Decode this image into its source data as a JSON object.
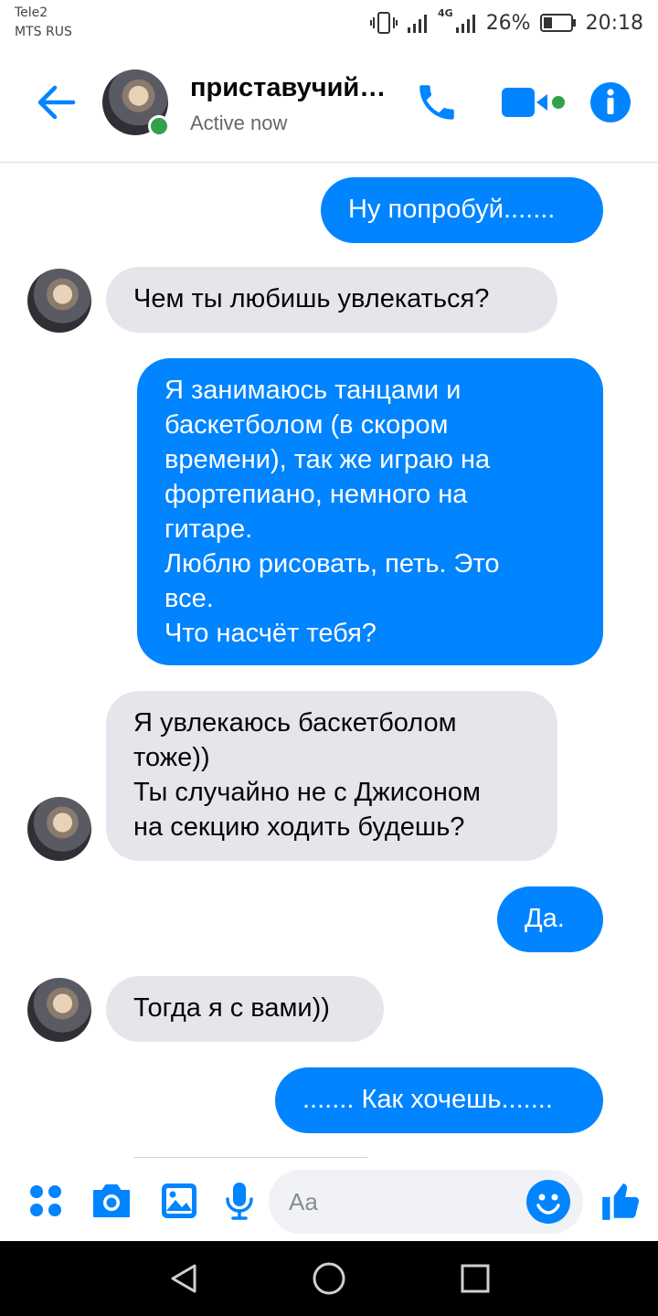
{
  "status_bar": {
    "carrier_line1": "Tele2",
    "carrier_line2": "MTS RUS",
    "network": "4G",
    "battery": "26%",
    "time": "20:18"
  },
  "header": {
    "contact_name": "приставучий…",
    "contact_status": "Active now",
    "icons": [
      "back-arrow-icon",
      "phone-icon",
      "video-camera-icon",
      "info-icon"
    ]
  },
  "messages": [
    {
      "direction": "outgoing",
      "text": "Ну попробуй......."
    },
    {
      "direction": "incoming",
      "text": "Чем ты любишь увлекаться?"
    },
    {
      "direction": "outgoing",
      "text": "Я занимаюсь танцами и\nбаскетболом (в скором\nвремени), так же играю на\nфортепиано, немного на\nгитаре.\nЛюблю рисовать, петь. Это\nвсе.\nЧто насчёт тебя?"
    },
    {
      "direction": "incoming",
      "text": "Я увлекаюсь баскетболом\nтоже))\nТы случайно не с Джисоном\nна секцию ходить будешь?"
    },
    {
      "direction": "outgoing",
      "text": "Да."
    },
    {
      "direction": "incoming",
      "text": "Тогда я с вами))"
    },
    {
      "direction": "outgoing",
      "text": "....... Как хочешь......."
    }
  ],
  "composer": {
    "placeholder": "Aa",
    "icons": [
      "apps-icon",
      "camera-icon",
      "gallery-icon",
      "microphone-icon",
      "emoji-icon",
      "like-icon"
    ]
  },
  "colors": {
    "accent": "#0084ff",
    "incoming_bubble": "#e4e6eb",
    "online": "#31a24c"
  }
}
